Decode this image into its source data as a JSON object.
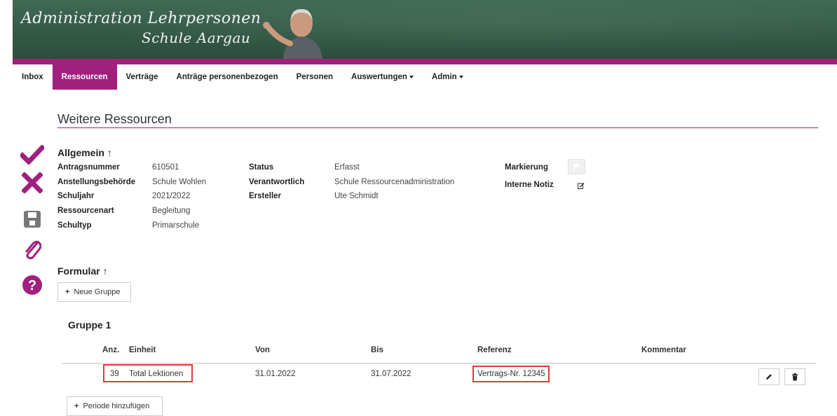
{
  "header": {
    "title_line1": "Administration Lehrpersonen",
    "title_line2": "Schule Aargau"
  },
  "nav": {
    "items": [
      {
        "label": "Inbox"
      },
      {
        "label": "Ressourcen",
        "active": true
      },
      {
        "label": "Verträge"
      },
      {
        "label": "Anträge personenbezogen"
      },
      {
        "label": "Personen"
      },
      {
        "label": "Auswertungen"
      },
      {
        "label": "Admin"
      }
    ]
  },
  "page": {
    "title": "Weitere Ressourcen"
  },
  "sidebar_actions": [
    "check-icon",
    "close-icon",
    "save-icon",
    "paperclip-icon",
    "help-icon"
  ],
  "allgemein": {
    "heading": "Allgemein",
    "arrow": "↑",
    "fields": {
      "antragsnummer_label": "Antragsnummer",
      "antragsnummer": "610501",
      "anstellungsbehoerde_label": "Anstellungsbehörde",
      "anstellungsbehoerde": "Schule Wohlen",
      "schuljahr_label": "Schuljahr",
      "schuljahr": "2021/2022",
      "ressourcenart_label": "Ressourcenart",
      "ressourcenart": "Begleitung",
      "schultyp_label": "Schultyp",
      "schultyp": "Primarschule",
      "status_label": "Status",
      "status": "Erfasst",
      "verantwortlich_label": "Verantwortlich",
      "verantwortlich": "Schule Ressourcenadministration",
      "ersteller_label": "Ersteller",
      "ersteller": "Ute Schmidt",
      "markierung_label": "Markierung",
      "interne_notiz_label": "Interne Notiz"
    }
  },
  "formular": {
    "heading": "Formular",
    "arrow": "↑",
    "new_group_label": "Neue Gruppe",
    "plus": "+"
  },
  "gruppe": {
    "title": "Gruppe 1",
    "columns": {
      "anz": "Anz.",
      "einheit": "Einheit",
      "von": "Von",
      "bis": "Bis",
      "referenz": "Referenz",
      "kommentar": "Kommentar"
    },
    "row": {
      "anz": "39",
      "einheit": "Total Lektionen",
      "von": "31.01.2022",
      "bis": "31.07.2022",
      "referenz": "Vertrags-Nr. 12345",
      "kommentar": ""
    },
    "add_period_label": "Periode hinzufügen"
  },
  "colors": {
    "accent": "#a0207e",
    "highlight": "#e23a3a"
  }
}
